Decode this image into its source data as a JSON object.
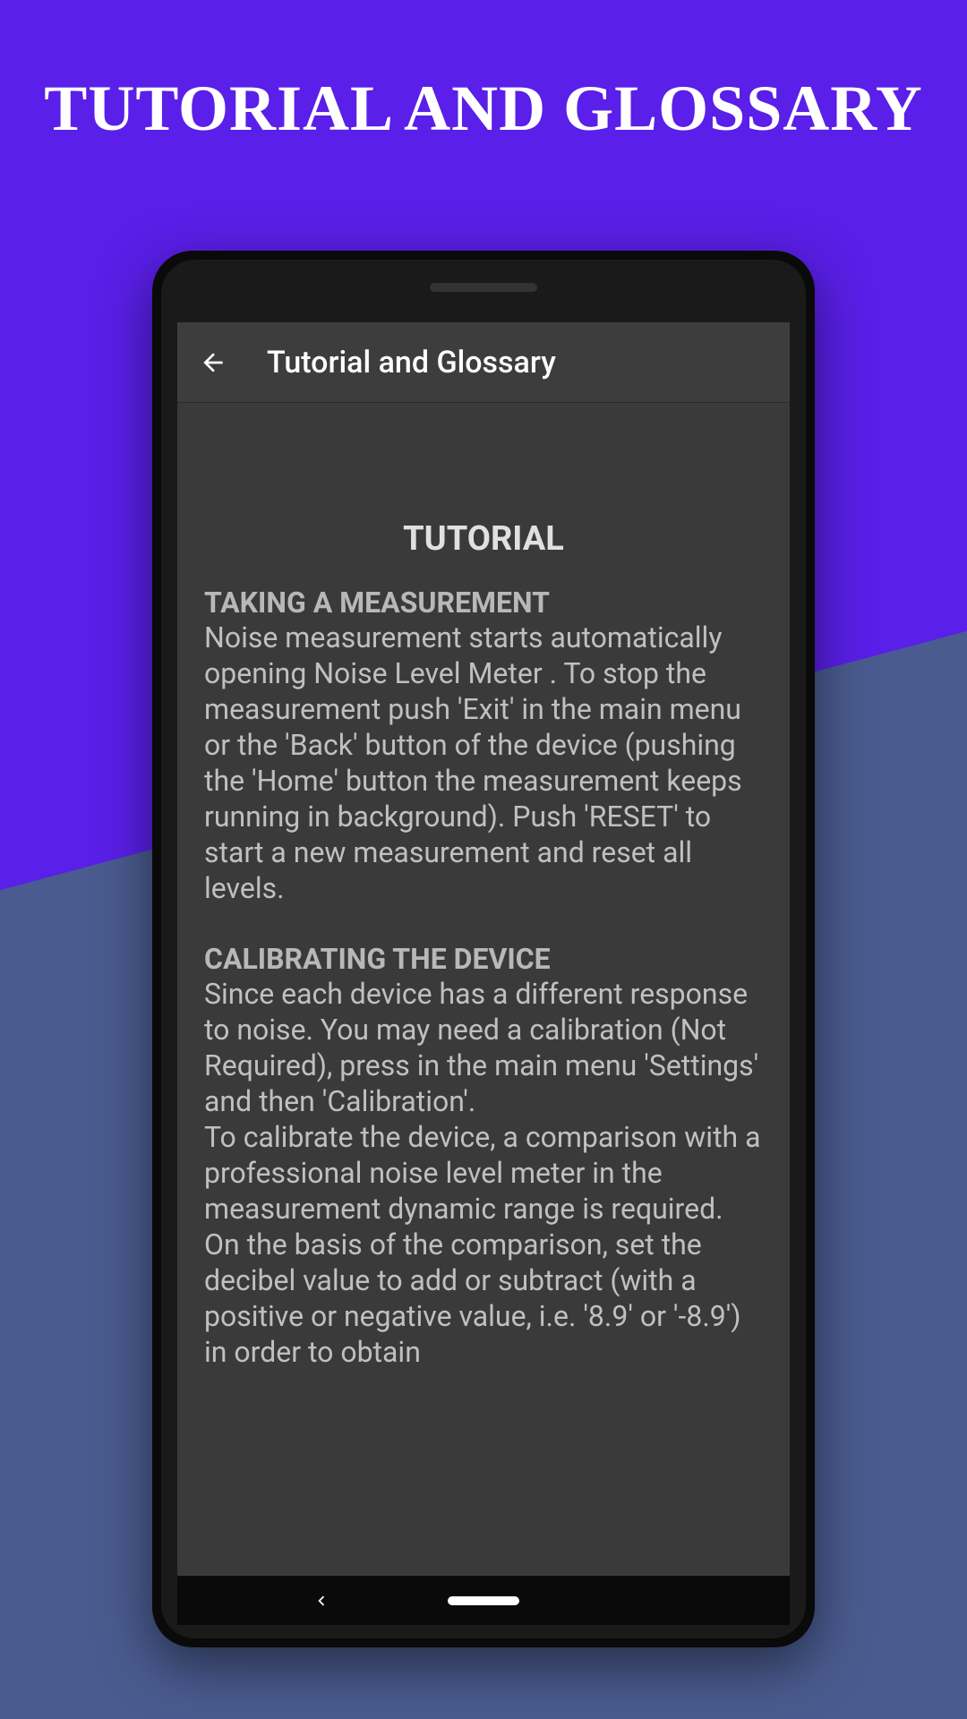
{
  "page": {
    "title": "TUTORIAL AND GLOSSARY"
  },
  "app": {
    "appBarTitle": "Tutorial and Glossary",
    "sectionTitle": "TUTORIAL",
    "subsection1": {
      "title": "TAKING A MEASUREMENT",
      "body": " Noise measurement starts automatically opening Noise Level Meter . To stop the measurement push 'Exit' in the main menu or the 'Back' button of the device (pushing the 'Home' button the measurement keeps running in background). Push 'RESET' to start a new measurement and reset all levels."
    },
    "subsection2": {
      "title": "CALIBRATING THE DEVICE",
      "body": " Since each device has a different response to noise. You may need a calibration (Not Required), press in the main menu 'Settings' and then 'Calibration'.\n To calibrate the device, a comparison with a professional noise level meter in the measurement dynamic range is required. On the basis of the comparison, set the decibel value to add or subtract (with a positive or negative value, i.e. '8.9' or '-8.9') in order to obtain"
    }
  }
}
